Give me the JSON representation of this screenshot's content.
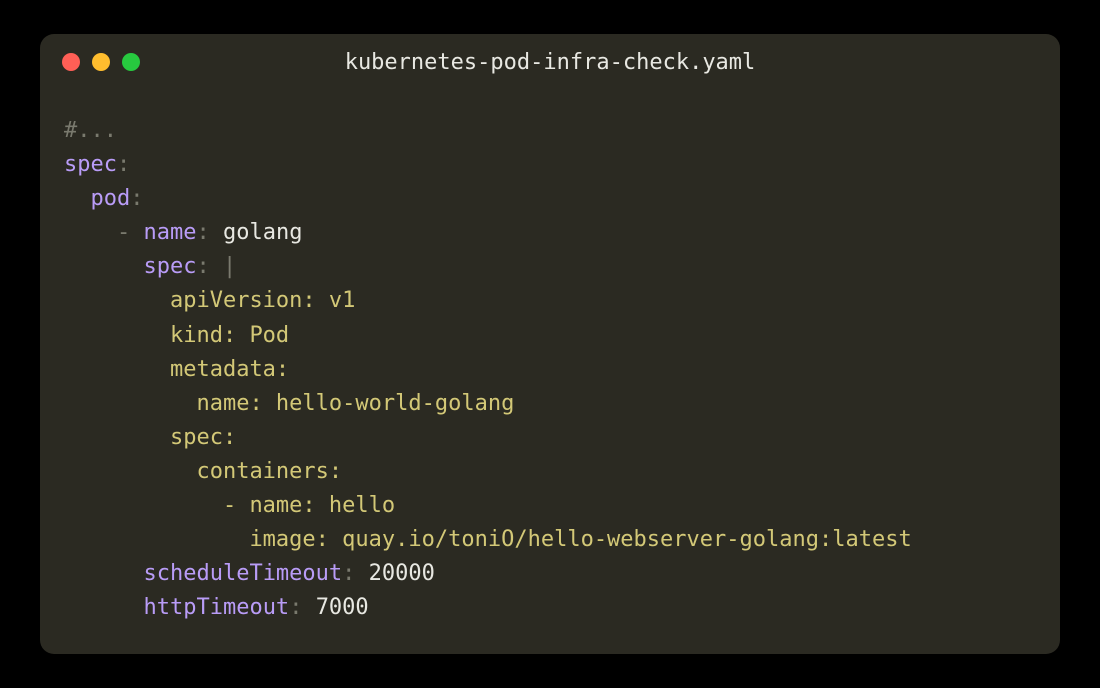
{
  "window": {
    "title": "kubernetes-pod-infra-check.yaml"
  },
  "code": {
    "line1_comment": "#...",
    "line2_key": "spec",
    "line3_key": "pod",
    "line4_dash": "-",
    "line4_key": "name",
    "line4_value": "golang",
    "line5_key": "spec",
    "line5_pipe": "|",
    "line6": "apiVersion: v1",
    "line7": "kind: Pod",
    "line8": "metadata:",
    "line9": "  name: hello-world-golang",
    "line10": "spec:",
    "line11": "  containers:",
    "line12": "    - name: hello",
    "line13": "      image: quay.io/toniO/hello-webserver-golang:latest",
    "line14_key": "scheduleTimeout",
    "line14_value": "20000",
    "line15_key": "httpTimeout",
    "line15_value": "7000"
  }
}
